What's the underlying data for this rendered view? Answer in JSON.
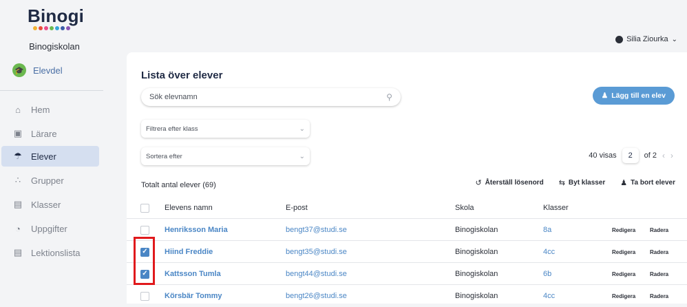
{
  "sidebar": {
    "logo": "Binogi",
    "logo_dot_colors": [
      "#f2b233",
      "#e94d3b",
      "#e94d8a",
      "#6bb84f",
      "#35a6d9",
      "#3b5ca8",
      "#8a55b5"
    ],
    "school": "Binogiskolan",
    "section_label": "Elevdel",
    "items": [
      {
        "label": "Hem",
        "icon": "home-icon"
      },
      {
        "label": "Lärare",
        "icon": "teacher-board-icon"
      },
      {
        "label": "Elever",
        "icon": "student-icon",
        "active": true
      },
      {
        "label": "Grupper",
        "icon": "group-icon"
      },
      {
        "label": "Klasser",
        "icon": "classroom-icon"
      },
      {
        "label": "Uppgifter",
        "icon": "pie-chart-icon"
      },
      {
        "label": "Lektionslista",
        "icon": "book-icon"
      }
    ]
  },
  "header": {
    "user_name": "Silia Ziourka"
  },
  "main": {
    "title": "Lista över elever",
    "search_placeholder": "Sök elevnamn",
    "add_button": "Lägg till en elev",
    "filter_placeholder": "Filtrera efter klass",
    "sort_placeholder": "Sortera efter",
    "pager": {
      "shown": "40 visas",
      "page": "2",
      "of": "of 2"
    },
    "total": "Totalt antal elever (69)",
    "actions": {
      "reset_password": "Återställ lösenord",
      "switch_classes": "Byt klasser",
      "remove_students": "Ta bort elever"
    },
    "columns": [
      "Elevens namn",
      "E-post",
      "Skola",
      "Klasser"
    ],
    "rows": [
      {
        "name": "Henriksson Maria",
        "email": "bengt37@studi.se",
        "school": "Binogiskolan",
        "klass": "8a",
        "checked": false
      },
      {
        "name": "Hiind Freddie",
        "email": "bengt35@studi.se",
        "school": "Binogiskolan",
        "klass": "4cc",
        "checked": true
      },
      {
        "name": "Kattsson Tumla",
        "email": "bengt44@studi.se",
        "school": "Binogiskolan",
        "klass": "6b",
        "checked": true
      },
      {
        "name": "Körsbär Tommy",
        "email": "bengt26@studi.se",
        "school": "Binogiskolan",
        "klass": "4cc",
        "checked": false
      }
    ],
    "edit_label": "Redigera",
    "delete_label": "Radera"
  },
  "colors": {
    "accent": "#5a9bd5",
    "link": "#4a86c5",
    "active_nav": "#d5dff0",
    "highlight": "#e0191c"
  }
}
